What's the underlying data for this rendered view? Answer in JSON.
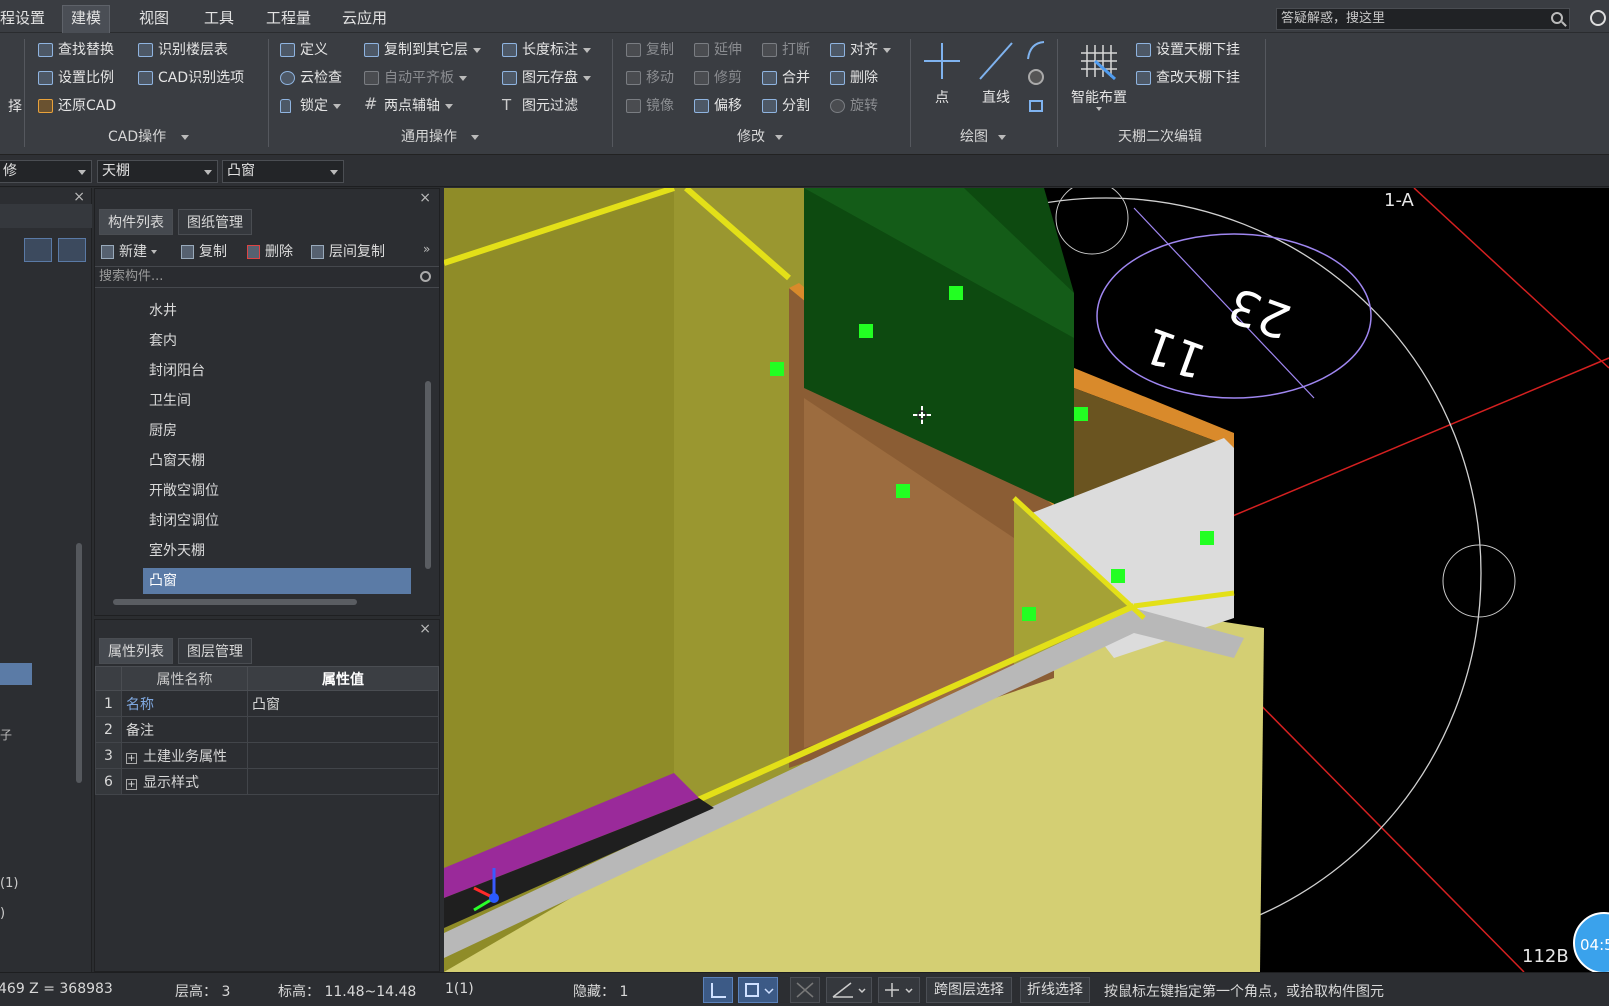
{
  "menubar": {
    "items": [
      "程设置",
      "建模",
      "视图",
      "工具",
      "工程量",
      "云应用"
    ],
    "active": "建模",
    "search_placeholder": "答疑解惑，搜这里"
  },
  "ribbon": {
    "cad": {
      "buttons": [
        "查找替换",
        "识别楼层表",
        "设置比例",
        "CAD识别选项",
        "还原CAD"
      ],
      "partial": "择",
      "group_label": "CAD操作"
    },
    "general": {
      "buttons": [
        "定义",
        "复制到其它层",
        "长度标注",
        "云检查",
        "自动平齐板",
        "图元存盘",
        "锁定",
        "两点辅轴",
        "图元过滤"
      ],
      "group_label": "通用操作"
    },
    "modify": {
      "buttons": [
        "复制",
        "延伸",
        "打断",
        "对齐",
        "移动",
        "修剪",
        "合并",
        "删除",
        "镜像",
        "偏移",
        "分割",
        "旋转"
      ],
      "group_label": "修改"
    },
    "draw": {
      "buttons": [
        "点",
        "直线"
      ],
      "group_label": "绘图"
    },
    "ceiling": {
      "big_button": "智能布置",
      "buttons": [
        "设置天棚下挂",
        "查改天棚下挂"
      ],
      "group_label": "天棚二次编辑"
    }
  },
  "strip": {
    "combo1": "修",
    "combo2": "天棚",
    "combo3": "凸窗"
  },
  "component_panel": {
    "tabs": [
      "构件列表",
      "图纸管理"
    ],
    "toolbar": [
      "新建",
      "复制",
      "删除",
      "层间复制"
    ],
    "search_placeholder": "搜索构件...",
    "items": [
      "水井",
      "套内",
      "封闭阳台",
      "卫生间",
      "厨房",
      "凸窗天棚",
      "开敞空调位",
      "封闭空调位",
      "室外天棚",
      "凸窗"
    ],
    "selected": "凸窗"
  },
  "property_panel": {
    "tabs": [
      "属性列表",
      "图层管理"
    ],
    "headers": [
      "属性名称",
      "属性值"
    ],
    "rows": [
      {
        "num": "1",
        "name": "名称",
        "value": "凸窗"
      },
      {
        "num": "2",
        "name": "备注",
        "value": ""
      },
      {
        "num": "3",
        "name": "土建业务属性",
        "value": ""
      },
      {
        "num": "6",
        "name": "显示样式",
        "value": ""
      }
    ]
  },
  "viewport": {
    "axis_label_top": "1-A",
    "axis_label_bottom": "112B",
    "bubble_text_1": "23",
    "bubble_text_2": "11",
    "timer": "04:5"
  },
  "statusbar": {
    "coords": "469 Z = 368983",
    "floor_height": "层高：   3",
    "elevation": "标高：   11.48~14.48",
    "count": "1(1)",
    "hidden": "隐藏：  1",
    "cross_floor": "跨图层选择",
    "polyline": "折线选择",
    "hint": "按鼠标左键指定第一个角点，或拾取构件图元"
  },
  "colors": {
    "accent_blue": "#5b7ba6",
    "yellow": "#e3e018",
    "green_marker": "#22ff22"
  },
  "left_nav": {
    "partial_1": "子",
    "partial_2": "(1)",
    "partial_3": ")"
  }
}
